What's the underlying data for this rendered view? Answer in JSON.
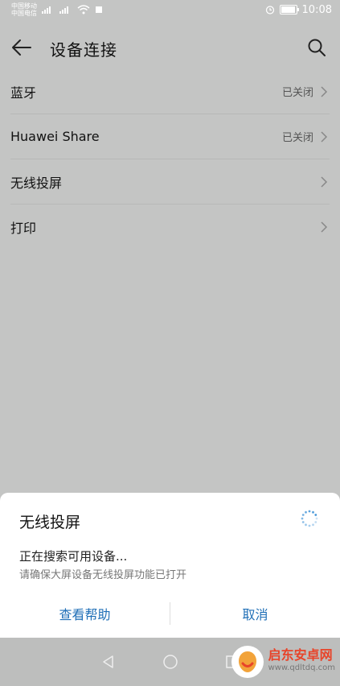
{
  "status_bar": {
    "carrier1": "中国移动",
    "carrier2": "中国电信",
    "time": "10:08",
    "battery_level": 0.85
  },
  "header": {
    "title": "设备连接",
    "back_icon": "arrow-left-icon",
    "search_icon": "search-icon"
  },
  "list": {
    "items": [
      {
        "label": "蓝牙",
        "status": "已关闭"
      },
      {
        "label": "Huawei Share",
        "status": "已关闭"
      },
      {
        "label": "无线投屏",
        "status": ""
      },
      {
        "label": "打印",
        "status": ""
      }
    ]
  },
  "dialog": {
    "title": "无线投屏",
    "message": "正在搜索可用设备...",
    "sub_message": "请确保大屏设备无线投屏功能已打开",
    "help_label": "查看帮助",
    "cancel_label": "取消"
  },
  "watermark": {
    "name": "启东安卓网",
    "url": "www.qdltdq.com"
  },
  "colors": {
    "accent": "#1f6fb7",
    "spinner": "#3a8fd6"
  }
}
